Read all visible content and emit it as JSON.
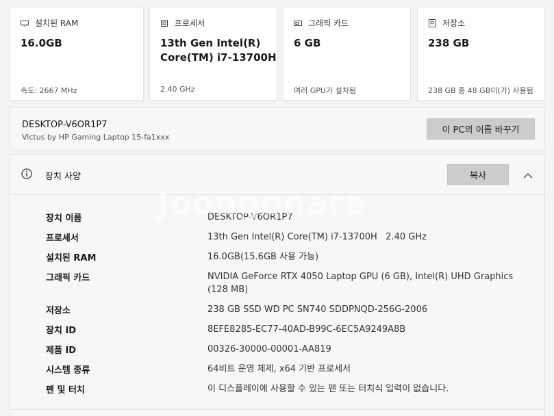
{
  "cards": [
    {
      "icon": "memory-icon",
      "title": "설치된 RAM",
      "value": "16.0GB",
      "sub": "속도: 2667 MHz"
    },
    {
      "icon": "processor-icon",
      "title": "프로세서",
      "value": "13th Gen Intel(R)\nCore(TM) i7-13700H",
      "sub": "2.40 GHz"
    },
    {
      "icon": "graphics-card-icon",
      "title": "그래픽 카드",
      "value": "6 GB",
      "sub": "여러 GPU가 설치됨"
    },
    {
      "icon": "storage-icon",
      "title": "저장소",
      "value": "238 GB",
      "sub": "238 GB 중 48 GB이(가) 사용됨"
    }
  ],
  "device": {
    "name": "DESKTOP-V6OR1P7",
    "model": "Victus by HP Gaming Laptop 15-fa1xxx",
    "rename_button": "이 PC의 이름 바꾸기"
  },
  "specs": {
    "title": "장치 사양",
    "copy_button": "복사",
    "rows": [
      {
        "label": "장치 이름",
        "value": "DESKTOP-V6OR1P7"
      },
      {
        "label": "프로세서",
        "value": "13th Gen Intel(R) Core(TM) i7-13700H   2.40 GHz"
      },
      {
        "label": "설치된 RAM",
        "value": "16.0GB(15.6GB 사용 가능)"
      },
      {
        "label": "그래픽 카드",
        "value": "NVIDIA GeForce RTX 4050 Laptop GPU (6 GB), Intel(R) UHD Graphics (128 MB)"
      },
      {
        "label": "저장소",
        "value": "238 GB SSD WD PC SN740 SDDPNQD-256G-2006"
      },
      {
        "label": "장치 ID",
        "value": "8EFE8285-EC77-40AD-B99C-6EC5A9249A8B"
      },
      {
        "label": "제품 ID",
        "value": "00326-30000-00001-AA819"
      },
      {
        "label": "시스템 종류",
        "value": "64비트 운영 체제, x64 기반 프로세서"
      },
      {
        "label": "펜 및 터치",
        "value": "이 디스플레이에 사용할 수 있는 펜 또는 터치식 입력이 없습니다."
      }
    ]
  },
  "watermark": "Joongonara"
}
